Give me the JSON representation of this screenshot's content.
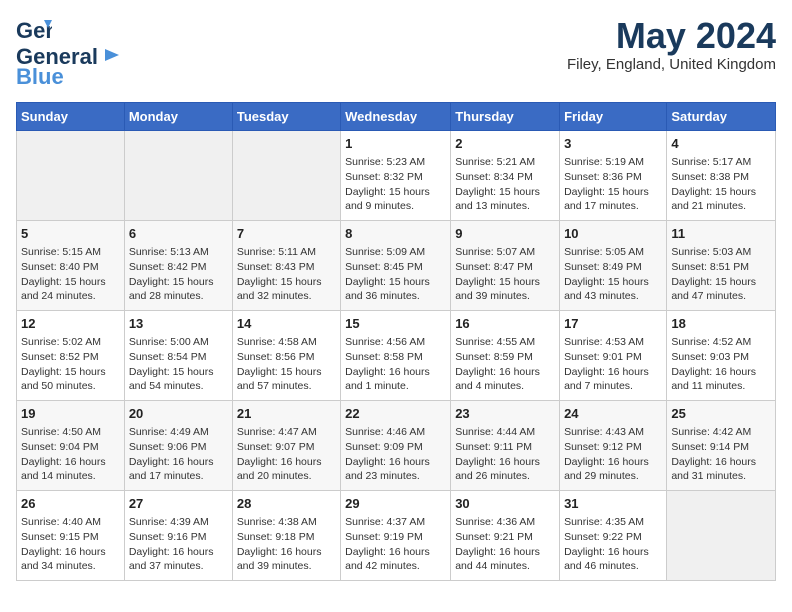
{
  "header": {
    "logo_general": "General",
    "logo_blue": "Blue",
    "month_year": "May 2024",
    "location": "Filey, England, United Kingdom"
  },
  "days_of_week": [
    "Sunday",
    "Monday",
    "Tuesday",
    "Wednesday",
    "Thursday",
    "Friday",
    "Saturday"
  ],
  "weeks": [
    [
      {
        "day": "",
        "info": ""
      },
      {
        "day": "",
        "info": ""
      },
      {
        "day": "",
        "info": ""
      },
      {
        "day": "1",
        "info": "Sunrise: 5:23 AM\nSunset: 8:32 PM\nDaylight: 15 hours\nand 9 minutes."
      },
      {
        "day": "2",
        "info": "Sunrise: 5:21 AM\nSunset: 8:34 PM\nDaylight: 15 hours\nand 13 minutes."
      },
      {
        "day": "3",
        "info": "Sunrise: 5:19 AM\nSunset: 8:36 PM\nDaylight: 15 hours\nand 17 minutes."
      },
      {
        "day": "4",
        "info": "Sunrise: 5:17 AM\nSunset: 8:38 PM\nDaylight: 15 hours\nand 21 minutes."
      }
    ],
    [
      {
        "day": "5",
        "info": "Sunrise: 5:15 AM\nSunset: 8:40 PM\nDaylight: 15 hours\nand 24 minutes."
      },
      {
        "day": "6",
        "info": "Sunrise: 5:13 AM\nSunset: 8:42 PM\nDaylight: 15 hours\nand 28 minutes."
      },
      {
        "day": "7",
        "info": "Sunrise: 5:11 AM\nSunset: 8:43 PM\nDaylight: 15 hours\nand 32 minutes."
      },
      {
        "day": "8",
        "info": "Sunrise: 5:09 AM\nSunset: 8:45 PM\nDaylight: 15 hours\nand 36 minutes."
      },
      {
        "day": "9",
        "info": "Sunrise: 5:07 AM\nSunset: 8:47 PM\nDaylight: 15 hours\nand 39 minutes."
      },
      {
        "day": "10",
        "info": "Sunrise: 5:05 AM\nSunset: 8:49 PM\nDaylight: 15 hours\nand 43 minutes."
      },
      {
        "day": "11",
        "info": "Sunrise: 5:03 AM\nSunset: 8:51 PM\nDaylight: 15 hours\nand 47 minutes."
      }
    ],
    [
      {
        "day": "12",
        "info": "Sunrise: 5:02 AM\nSunset: 8:52 PM\nDaylight: 15 hours\nand 50 minutes."
      },
      {
        "day": "13",
        "info": "Sunrise: 5:00 AM\nSunset: 8:54 PM\nDaylight: 15 hours\nand 54 minutes."
      },
      {
        "day": "14",
        "info": "Sunrise: 4:58 AM\nSunset: 8:56 PM\nDaylight: 15 hours\nand 57 minutes."
      },
      {
        "day": "15",
        "info": "Sunrise: 4:56 AM\nSunset: 8:58 PM\nDaylight: 16 hours\nand 1 minute."
      },
      {
        "day": "16",
        "info": "Sunrise: 4:55 AM\nSunset: 8:59 PM\nDaylight: 16 hours\nand 4 minutes."
      },
      {
        "day": "17",
        "info": "Sunrise: 4:53 AM\nSunset: 9:01 PM\nDaylight: 16 hours\nand 7 minutes."
      },
      {
        "day": "18",
        "info": "Sunrise: 4:52 AM\nSunset: 9:03 PM\nDaylight: 16 hours\nand 11 minutes."
      }
    ],
    [
      {
        "day": "19",
        "info": "Sunrise: 4:50 AM\nSunset: 9:04 PM\nDaylight: 16 hours\nand 14 minutes."
      },
      {
        "day": "20",
        "info": "Sunrise: 4:49 AM\nSunset: 9:06 PM\nDaylight: 16 hours\nand 17 minutes."
      },
      {
        "day": "21",
        "info": "Sunrise: 4:47 AM\nSunset: 9:07 PM\nDaylight: 16 hours\nand 20 minutes."
      },
      {
        "day": "22",
        "info": "Sunrise: 4:46 AM\nSunset: 9:09 PM\nDaylight: 16 hours\nand 23 minutes."
      },
      {
        "day": "23",
        "info": "Sunrise: 4:44 AM\nSunset: 9:11 PM\nDaylight: 16 hours\nand 26 minutes."
      },
      {
        "day": "24",
        "info": "Sunrise: 4:43 AM\nSunset: 9:12 PM\nDaylight: 16 hours\nand 29 minutes."
      },
      {
        "day": "25",
        "info": "Sunrise: 4:42 AM\nSunset: 9:14 PM\nDaylight: 16 hours\nand 31 minutes."
      }
    ],
    [
      {
        "day": "26",
        "info": "Sunrise: 4:40 AM\nSunset: 9:15 PM\nDaylight: 16 hours\nand 34 minutes."
      },
      {
        "day": "27",
        "info": "Sunrise: 4:39 AM\nSunset: 9:16 PM\nDaylight: 16 hours\nand 37 minutes."
      },
      {
        "day": "28",
        "info": "Sunrise: 4:38 AM\nSunset: 9:18 PM\nDaylight: 16 hours\nand 39 minutes."
      },
      {
        "day": "29",
        "info": "Sunrise: 4:37 AM\nSunset: 9:19 PM\nDaylight: 16 hours\nand 42 minutes."
      },
      {
        "day": "30",
        "info": "Sunrise: 4:36 AM\nSunset: 9:21 PM\nDaylight: 16 hours\nand 44 minutes."
      },
      {
        "day": "31",
        "info": "Sunrise: 4:35 AM\nSunset: 9:22 PM\nDaylight: 16 hours\nand 46 minutes."
      },
      {
        "day": "",
        "info": ""
      }
    ]
  ]
}
